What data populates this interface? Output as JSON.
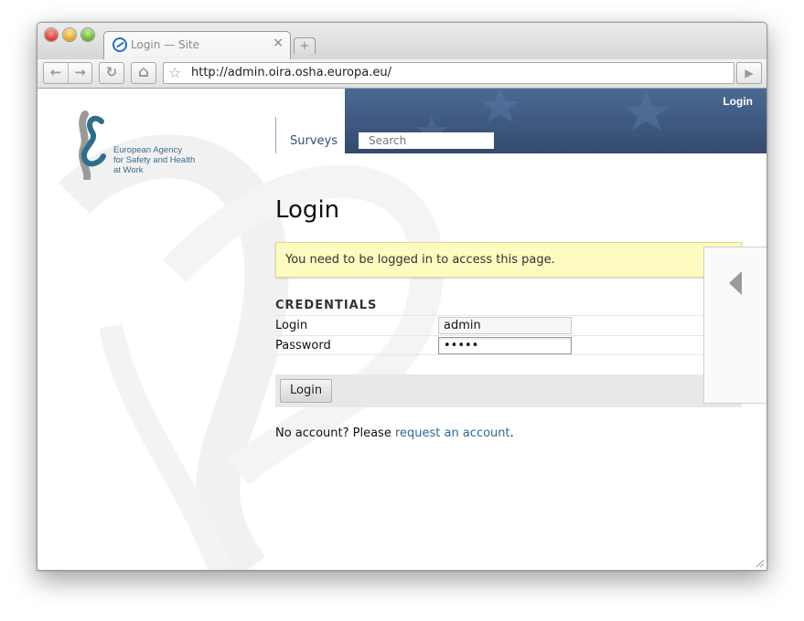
{
  "browser": {
    "tab_title": "Login — Site",
    "tab_close_glyph": "×",
    "new_tab_glyph": "+",
    "back_glyph": "←",
    "forward_glyph": "→",
    "reload_glyph": "↻",
    "home_glyph": "⌂",
    "bookmark_glyph": "☆",
    "go_glyph": "▶",
    "url": "http://admin.oira.osha.europa.eu/"
  },
  "site": {
    "logo_lines": [
      "European Agency",
      "for Safety and Health",
      "at Work"
    ],
    "top_login": "Login",
    "nav_surveys": "Surveys",
    "search_placeholder": "Search"
  },
  "main": {
    "title": "Login",
    "notice": "You need to be logged in to access this page.",
    "credentials_heading": "CREDENTIALS",
    "login_label": "Login",
    "login_value": "admin",
    "password_label": "Password",
    "password_value": "•••••",
    "login_button": "Login",
    "account_prefix": "No account? Please ",
    "account_link": "request an account",
    "account_suffix": "."
  },
  "colors": {
    "banner": "#3c557c",
    "notice_bg": "#fdfbbf",
    "link": "#2e6a96"
  }
}
